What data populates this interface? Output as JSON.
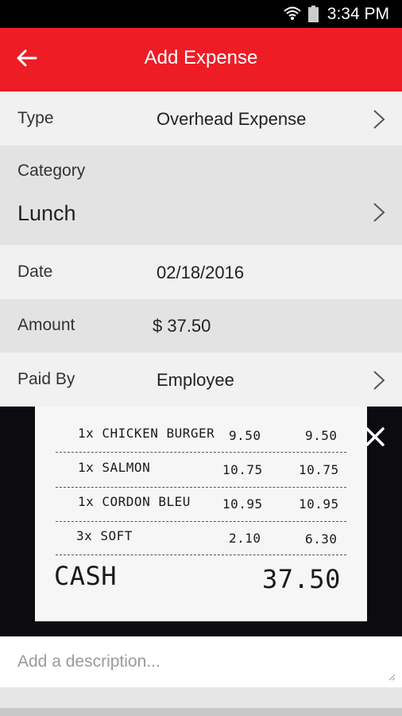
{
  "status_bar": {
    "time": "3:34 PM"
  },
  "app_bar": {
    "title": "Add Expense"
  },
  "form": {
    "type": {
      "label": "Type",
      "value": "Overhead Expense"
    },
    "category": {
      "label": "Category",
      "value": "Lunch"
    },
    "date": {
      "label": "Date",
      "value": "02/18/2016"
    },
    "amount": {
      "label": "Amount",
      "value": "$ 37.50"
    },
    "paid_by": {
      "label": "Paid By",
      "value": "Employee"
    }
  },
  "receipt": {
    "items": [
      {
        "desc": "1x CHICKEN BURGER",
        "price": "9.50",
        "total": "9.50"
      },
      {
        "desc": "1x SALMON",
        "price": "10.75",
        "total": "10.75"
      },
      {
        "desc": "1x CORDON BLEU",
        "price": "10.95",
        "total": "10.95"
      },
      {
        "desc": "3x SOFT",
        "price": "2.10",
        "total": "6.30"
      }
    ],
    "payment_label": "CASH",
    "payment_total": "37.50"
  },
  "description": {
    "placeholder": "Add a description..."
  },
  "colors": {
    "accent": "#ee1c25",
    "row_light": "#f1f1f1",
    "row_dark": "#e3e3e3"
  }
}
